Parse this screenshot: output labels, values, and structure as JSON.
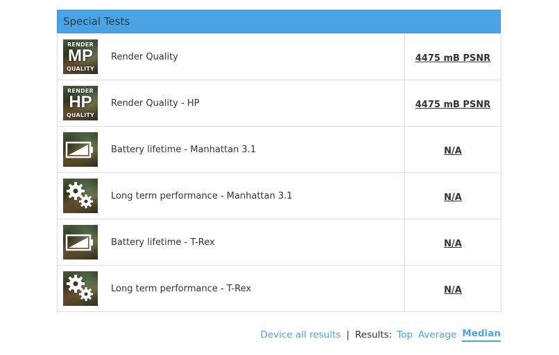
{
  "panel": {
    "title": "Special Tests"
  },
  "tests": [
    {
      "name": "Render Quality",
      "value": "4475 mB PSNR",
      "icon": "render-mp-icon",
      "icon_top": "RENDER",
      "icon_big": "MP",
      "icon_bottom": "QUALITY"
    },
    {
      "name": "Render Quality - HP",
      "value": "4475 mB PSNR",
      "icon": "render-hp-icon",
      "icon_top": "RENDER",
      "icon_big": "HP",
      "icon_bottom": "QUALITY"
    },
    {
      "name": "Battery lifetime - Manhattan 3.1",
      "value": "N/A",
      "icon": "battery-icon"
    },
    {
      "name": "Long term performance - Manhattan 3.1",
      "value": "N/A",
      "icon": "gears-icon"
    },
    {
      "name": "Battery lifetime - T-Rex",
      "value": "N/A",
      "icon": "battery-icon"
    },
    {
      "name": "Long term performance - T-Rex",
      "value": "N/A",
      "icon": "gears-icon"
    }
  ],
  "footer": {
    "device_all_results": "Device all results",
    "separator": "|",
    "results_label": "Results:",
    "options": [
      "Top",
      "Average",
      "Median"
    ],
    "active_option": "Median"
  },
  "colors": {
    "accent": "#4aa3e3",
    "text": "#333333",
    "border": "#dcdcdc"
  }
}
